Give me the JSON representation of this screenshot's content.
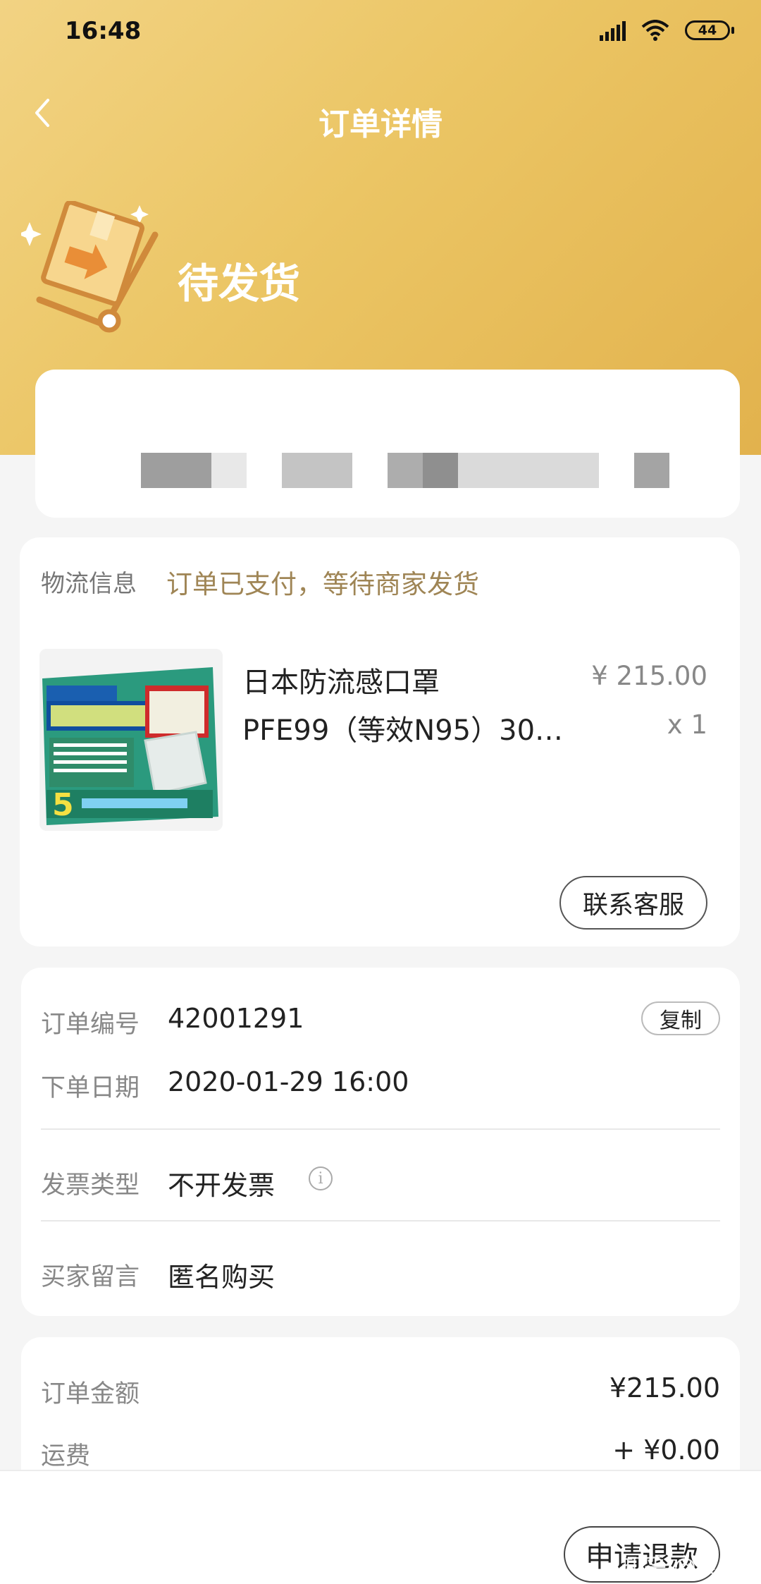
{
  "status_bar": {
    "time": "16:48",
    "battery": "44"
  },
  "nav": {
    "title": "订单详情"
  },
  "order_status": {
    "label": "待发货"
  },
  "logistics": {
    "label": "物流信息",
    "value": "订单已支付，等待商家发货"
  },
  "product": {
    "title_line1": "日本防流感口罩",
    "title_line2": "PFE99（等效N95）30…",
    "price": "¥ 215.00",
    "quantity": "x 1"
  },
  "buttons": {
    "contact_service": "联系客服",
    "copy": "复制",
    "refund": "申请退款"
  },
  "order_info": {
    "order_no_label": "订单编号",
    "order_no": "42001291",
    "date_label": "下单日期",
    "date": "2020-01-29 16:00",
    "invoice_label": "发票类型",
    "invoice": "不开发票",
    "message_label": "买家留言",
    "message": "匿名购买"
  },
  "amount": {
    "order_amount_label": "订单金额",
    "order_amount": "¥215.00",
    "shipping_label": "运费",
    "shipping": "+ ¥0.00"
  },
  "watermark": "知乎 @贝多",
  "colors": {
    "header_gold": "#ebc564",
    "logistics_text": "#9f8555"
  }
}
